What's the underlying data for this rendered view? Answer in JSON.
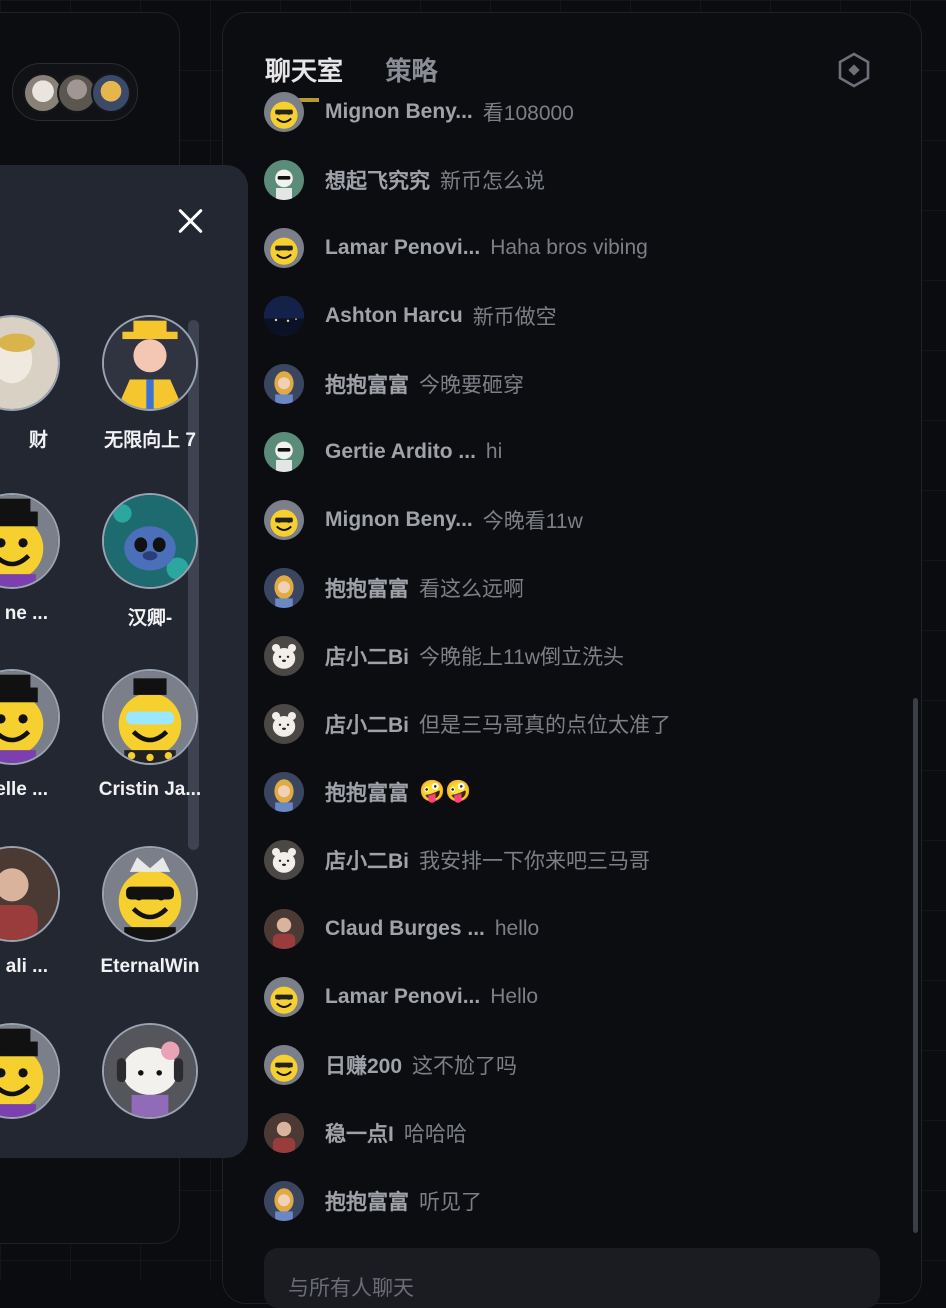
{
  "tabs": {
    "chat_room": "聊天室",
    "strategy": "策略"
  },
  "popup": {
    "members": [
      {
        "name": "财",
        "avatar": "photo-avatar"
      },
      {
        "name": "无限向上 7",
        "avatar": "yellow-hat-avatar"
      },
      {
        "name": "ne ...",
        "avatar": "smiley-hat-avatar"
      },
      {
        "name": "汉卿-",
        "avatar": "stitch-avatar"
      },
      {
        "name": "elle ...",
        "avatar": "smiley-hat-avatar"
      },
      {
        "name": "Cristin Ja...",
        "avatar": "smiley-sunglasses-avatar"
      },
      {
        "name": "ali ...",
        "avatar": "person-avatar"
      },
      {
        "name": "EternalWin",
        "avatar": "smiley-crown-avatar"
      },
      {
        "name": "",
        "avatar": "smiley-hat-avatar"
      },
      {
        "name": "",
        "avatar": "hello-kitty-avatar"
      }
    ]
  },
  "messages": [
    {
      "user": "Mignon Beny...",
      "text": "看108000",
      "avatar": "smiley-avatar"
    },
    {
      "user": "想起飞究究",
      "text": "新币怎么说",
      "avatar": "cartoon-avatar"
    },
    {
      "user": "Lamar Penovi...",
      "text": "Haha bros vibing",
      "avatar": "smiley-avatar"
    },
    {
      "user": "Ashton Harcu",
      "text": "新币做空",
      "avatar": "night-photo-avatar"
    },
    {
      "user": "抱抱富富",
      "text": "今晚要砸穿",
      "avatar": "girl-avatar"
    },
    {
      "user": "Gertie Ardito ...",
      "text": "hi",
      "avatar": "cartoon-avatar"
    },
    {
      "user": "Mignon Beny...",
      "text": "今晚看11w",
      "avatar": "smiley-avatar"
    },
    {
      "user": "抱抱富富",
      "text": "看这么远啊",
      "avatar": "girl-avatar"
    },
    {
      "user": "店小二Bi",
      "text": "今晚能上11w倒立洗头",
      "avatar": "bear-avatar"
    },
    {
      "user": "店小二Bi",
      "text": "但是三马哥真的点位太准了",
      "avatar": "bear-avatar"
    },
    {
      "user": "抱抱富富",
      "text": "🤪🤪",
      "avatar": "girl-avatar"
    },
    {
      "user": "店小二Bi",
      "text": "我安排一下你来吧三马哥",
      "avatar": "bear-avatar"
    },
    {
      "user": "Claud Burges ...",
      "text": "hello",
      "avatar": "person-avatar"
    },
    {
      "user": "Lamar Penovi...",
      "text": "Hello",
      "avatar": "smiley-avatar"
    },
    {
      "user": "日赚200",
      "text": "这不尬了吗",
      "avatar": "smiley-avatar"
    },
    {
      "user": "稳一点I",
      "text": "哈哈哈",
      "avatar": "person-avatar"
    },
    {
      "user": "抱抱富富",
      "text": "听见了",
      "avatar": "girl-avatar"
    }
  ],
  "input": {
    "placeholder": "与所有人聊天"
  },
  "colors": {
    "popup_bg": "#222731",
    "page_bg": "#0b0c0f",
    "smiley_yellow": "#f6d02e",
    "accent_gold": "#b59a2c"
  }
}
